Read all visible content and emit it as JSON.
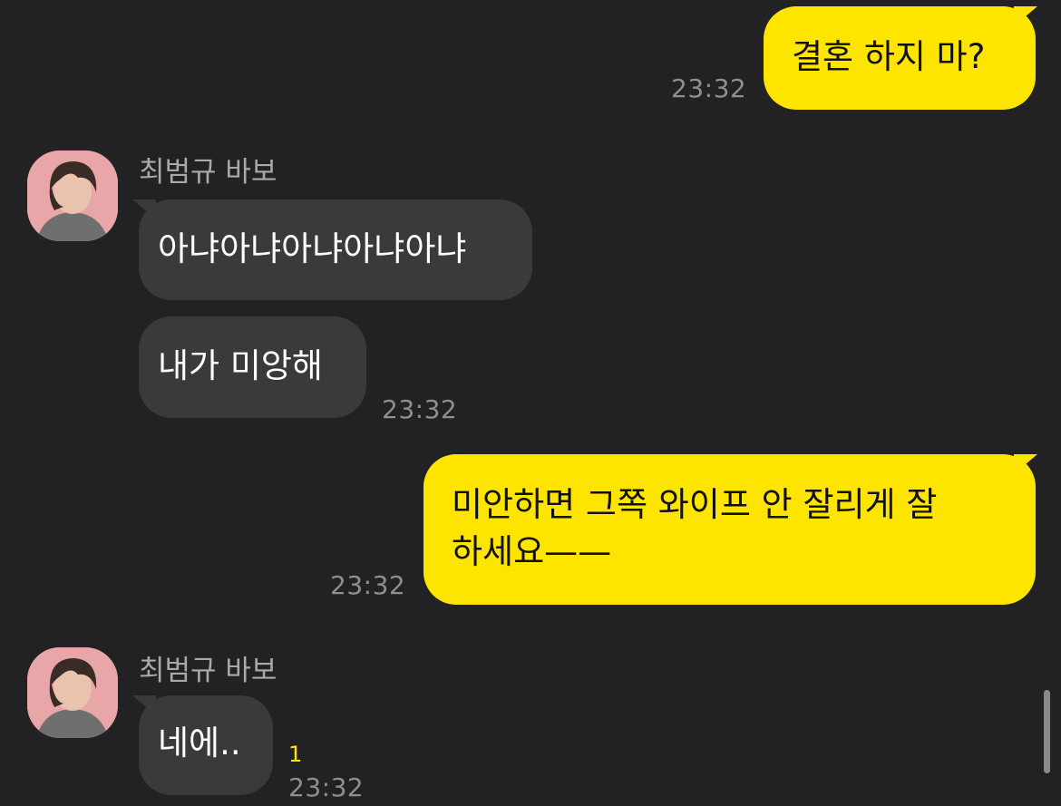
{
  "messages": [
    {
      "side": "me",
      "text": "결혼 하지 마?",
      "time": "23:32"
    },
    {
      "side": "them",
      "sender": "최범규 바보",
      "text": "아냐아냐아냐아냐아냐"
    },
    {
      "side": "them",
      "text": "내가 미앙해",
      "time": "23:32"
    },
    {
      "side": "me",
      "line1": "미안하면 그쪽 와이프 안 잘리게 잘",
      "line2": "하세요——",
      "time": "23:32"
    },
    {
      "side": "them",
      "sender": "최범규 바보",
      "text": "네에..",
      "unread": "1",
      "time": "23:32"
    }
  ],
  "colors": {
    "background": "#222224",
    "my_bubble": "#fee500",
    "their_bubble": "#3a3a3c",
    "timestamp": "#8e8e93",
    "unread": "#fee500"
  },
  "icons": [
    "avatar-photo"
  ]
}
